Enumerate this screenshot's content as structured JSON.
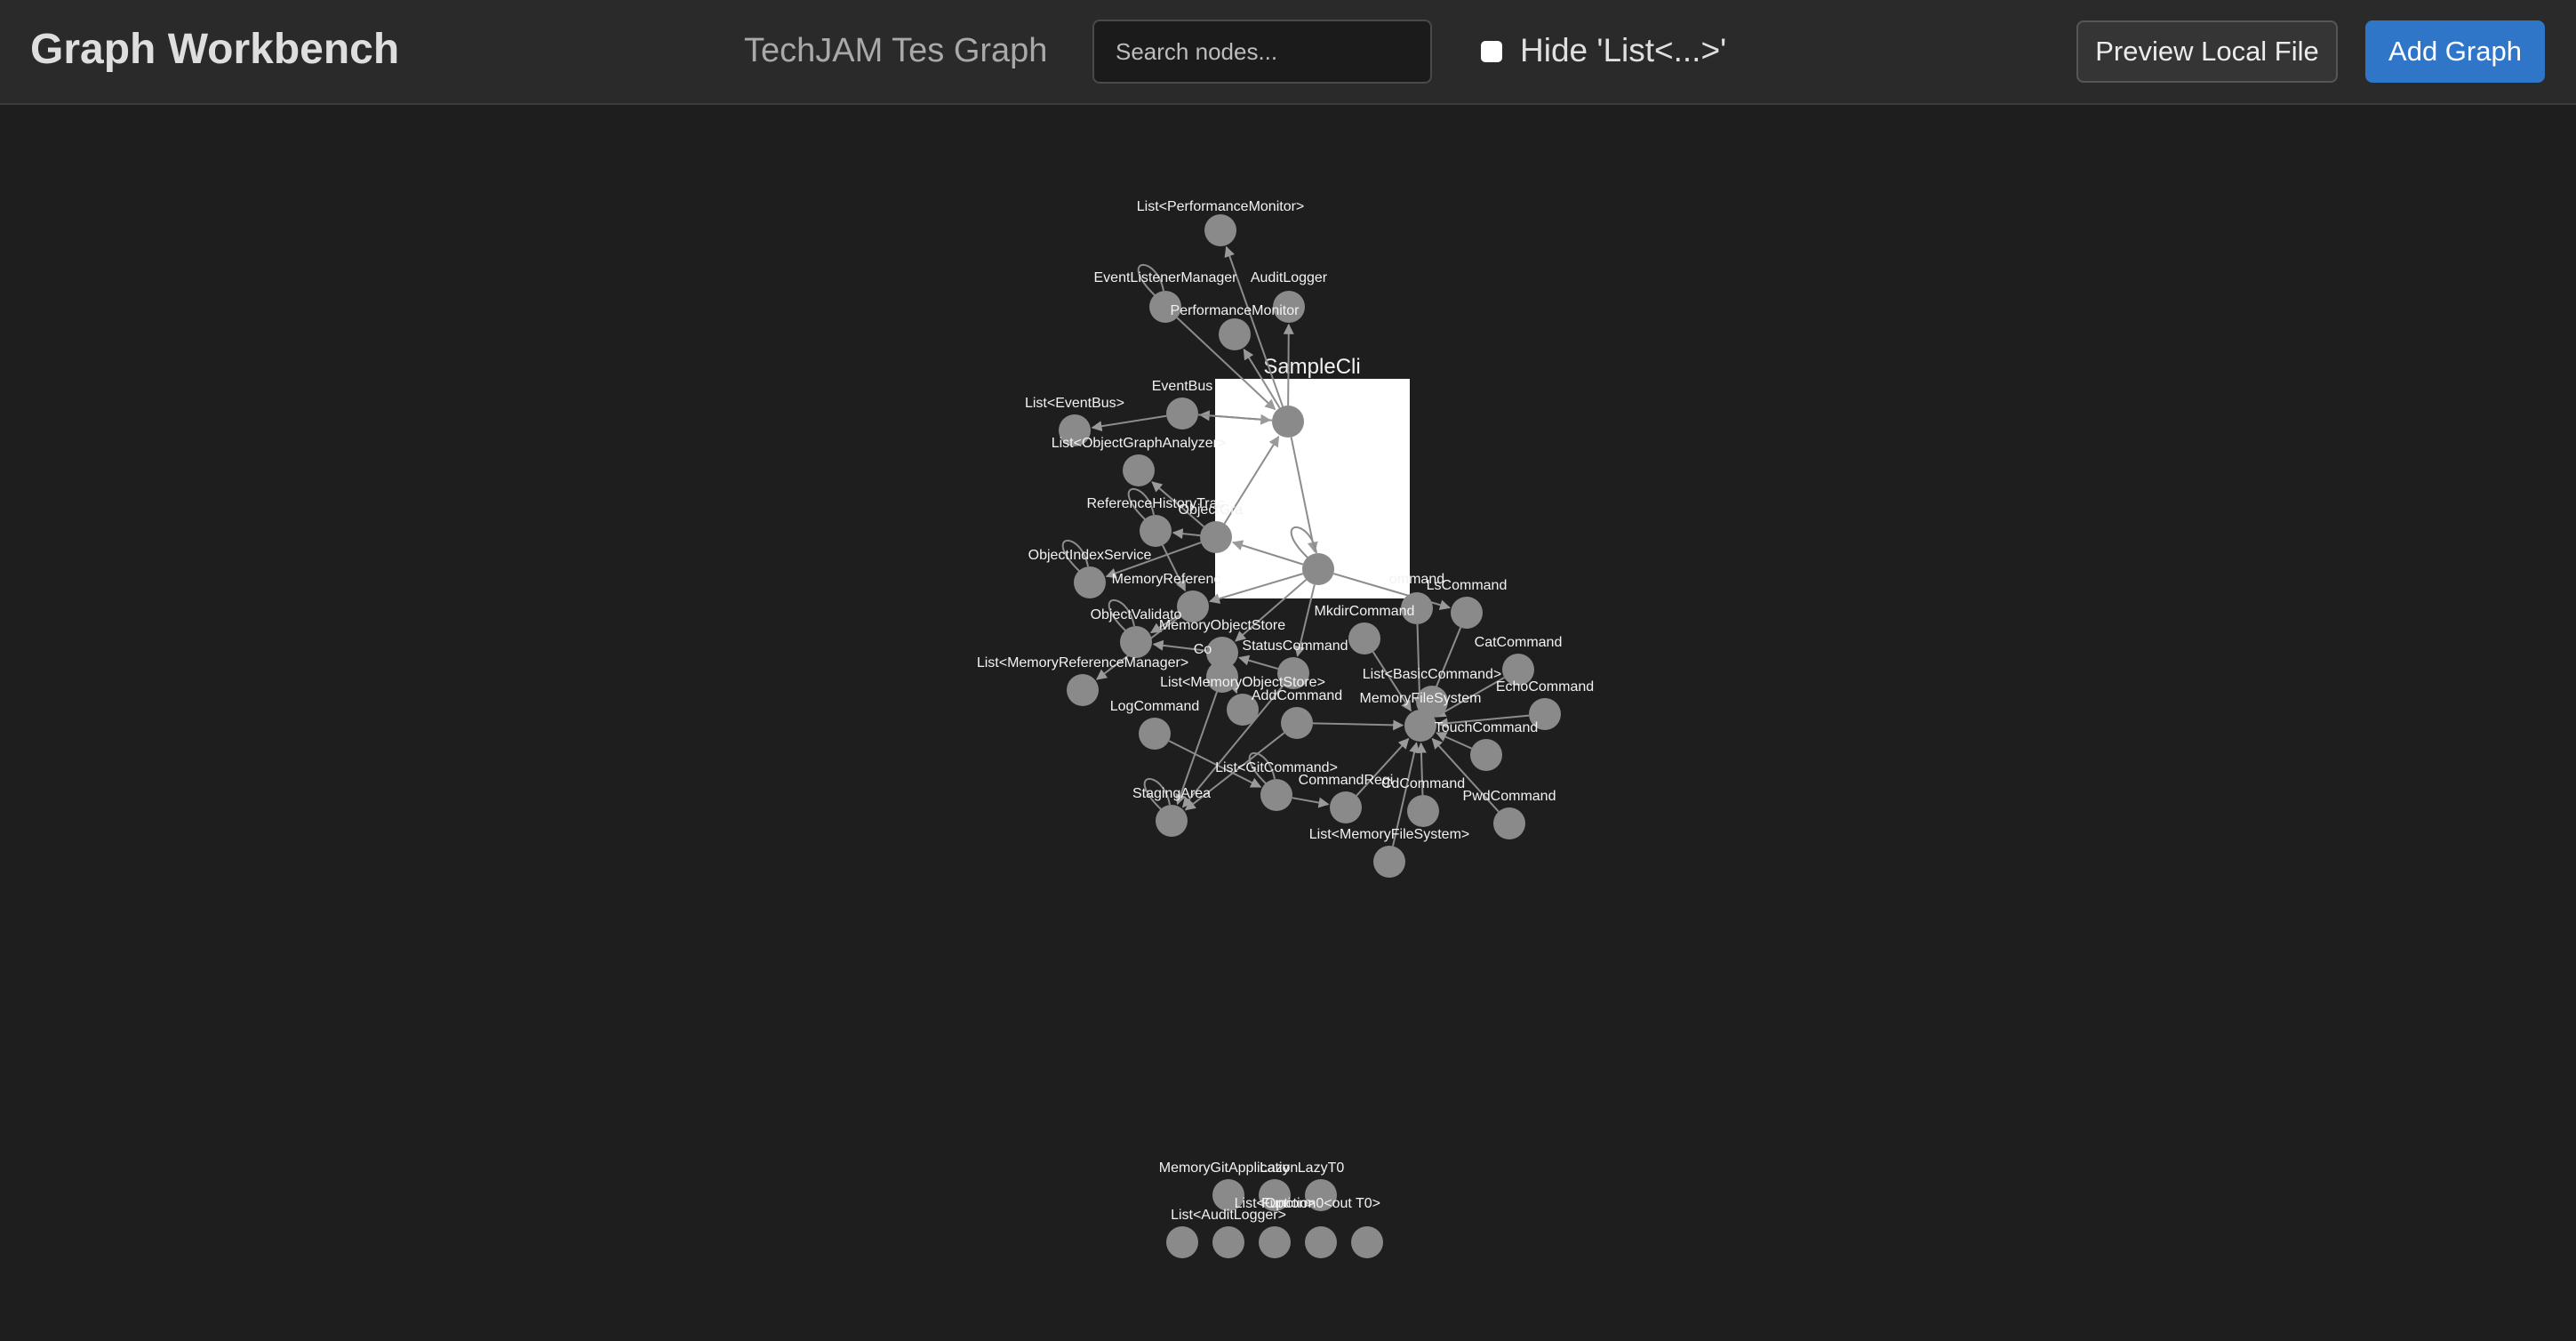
{
  "header": {
    "app_title": "Graph Workbench",
    "graph_name": "TechJAM Tes Graph",
    "search_placeholder": "Search nodes...",
    "hide_list_label": "Hide 'List<...>'",
    "hide_list_checked": false,
    "preview_label": "Preview Local File",
    "add_label": "Add Graph"
  },
  "colors": {
    "background": "#1e1e1e",
    "header": "#2a2a2a",
    "node": "#8a8a8a",
    "edge": "#8c8c8c",
    "accent": "#2f76c9",
    "cluster_box": "#ffffff"
  },
  "graph": {
    "cluster": {
      "label": "SampleCli"
    },
    "nodes": [
      {
        "id": "List<PerformanceMonitor>",
        "label": "List<PerformanceMonitor>"
      },
      {
        "id": "EventListenerManager",
        "label": "EventListenerManager"
      },
      {
        "id": "AuditLogger",
        "label": "AuditLogger"
      },
      {
        "id": "PerformanceMonitor",
        "label": "PerformanceMonitor"
      },
      {
        "id": "EventBus",
        "label": "EventBus"
      },
      {
        "id": "List<EventBus>",
        "label": "List<EventBus>"
      },
      {
        "id": "SampleCliTop",
        "label": ""
      },
      {
        "id": "List<ObjectGraphAnalyzer>",
        "label": "List<ObjectGraphAnalyzer>"
      },
      {
        "id": "ReferenceHistoryTracker",
        "label": "ReferenceHistoryTrac"
      },
      {
        "id": "ObjectGraph",
        "label": "ObjectGra"
      },
      {
        "id": "SampleCliBottom",
        "label": ""
      },
      {
        "id": "ObjectIndexService",
        "label": "ObjectIndexService"
      },
      {
        "id": "MemoryReferenceManager",
        "label": "MemoryReferenc"
      },
      {
        "id": "LsCommand",
        "label": "LsCommand"
      },
      {
        "id": "RmCommand",
        "label": "ommand"
      },
      {
        "id": "ObjectValidator",
        "label": "ObjectValidato"
      },
      {
        "id": "MemoryObjectStore",
        "label": "MemoryObjectStore"
      },
      {
        "id": "MkdirCommand",
        "label": "MkdirCommand"
      },
      {
        "id": "CommitCommand",
        "label": "Co"
      },
      {
        "id": "StatusCommand",
        "label": "StatusCommand"
      },
      {
        "id": "CatCommand",
        "label": "CatCommand"
      },
      {
        "id": "List<MemoryReferenceManager>",
        "label": "List<MemoryReferenceManager>"
      },
      {
        "id": "List<MemoryObjectStore>",
        "label": "List<MemoryObjectStore>"
      },
      {
        "id": "List<BasicCommand>",
        "label": "List<BasicCommand>"
      },
      {
        "id": "EchoCommand",
        "label": "EchoCommand"
      },
      {
        "id": "AddCommand",
        "label": "AddCommand"
      },
      {
        "id": "MemoryFileSystem",
        "label": "MemoryFileSystem"
      },
      {
        "id": "LogCommand",
        "label": "LogCommand"
      },
      {
        "id": "TouchCommand",
        "label": "TouchCommand"
      },
      {
        "id": "List<GitCommand>",
        "label": "List<GitCommand>"
      },
      {
        "id": "CommandRegistry",
        "label": "CommandRegi"
      },
      {
        "id": "CdCommand",
        "label": "CdCommand"
      },
      {
        "id": "StagingArea",
        "label": "StagingArea"
      },
      {
        "id": "PwdCommand",
        "label": "PwdCommand"
      },
      {
        "id": "List<MemoryFileSystem>",
        "label": "List<MemoryFileSystem>"
      },
      {
        "id": "MemoryGitApplication",
        "label": "MemoryGitApplication"
      },
      {
        "id": "Lazy",
        "label": "Lazy"
      },
      {
        "id": "LazyT0",
        "label": "LazyT0"
      },
      {
        "id": "List<Option>",
        "label": "List<Option>"
      },
      {
        "id": "Function0",
        "label": "Function0<out T0>"
      },
      {
        "id": "List<AuditLogger>",
        "label": "List<AuditLogger>"
      },
      {
        "id": "Isolated5",
        "label": ""
      },
      {
        "id": "Isolated6",
        "label": ""
      }
    ],
    "edges": [
      [
        "SampleCliTop",
        "List<PerformanceMonitor>"
      ],
      [
        "SampleCliTop",
        "AuditLogger"
      ],
      [
        "SampleCliTop",
        "PerformanceMonitor"
      ],
      [
        "SampleCliTop",
        "EventBus"
      ],
      [
        "EventListenerManager",
        "SampleCliTop"
      ],
      [
        "EventBus",
        "List<EventBus>"
      ],
      [
        "EventBus",
        "SampleCliTop"
      ],
      [
        "ObjectGraph",
        "SampleCliTop"
      ],
      [
        "SampleCliTop",
        "SampleCliBottom"
      ],
      [
        "SampleCliBottom",
        "ObjectGraph"
      ],
      [
        "SampleCliBottom",
        "MemoryReferenceManager"
      ],
      [
        "SampleCliBottom",
        "MemoryObjectStore"
      ],
      [
        "ObjectGraph",
        "List<ObjectGraphAnalyzer>"
      ],
      [
        "ObjectGraph",
        "ReferenceHistoryTracker"
      ],
      [
        "ObjectGraph",
        "ObjectIndexService"
      ],
      [
        "MemoryReferenceManager",
        "List<MemoryReferenceManager>"
      ],
      [
        "MemoryReferenceManager",
        "ObjectValidator"
      ],
      [
        "MemoryObjectStore",
        "List<MemoryObjectStore>"
      ],
      [
        "MemoryObjectStore",
        "ObjectValidator"
      ],
      [
        "CommitCommand",
        "MemoryObjectStore"
      ],
      [
        "CommitCommand",
        "StagingArea"
      ],
      [
        "StatusCommand",
        "StagingArea"
      ],
      [
        "AddCommand",
        "StagingArea"
      ],
      [
        "LogCommand",
        "List<GitCommand>"
      ],
      [
        "AddCommand",
        "MemoryFileSystem"
      ],
      [
        "List<GitCommand>",
        "CommandRegistry"
      ],
      [
        "CommandRegistry",
        "MemoryFileSystem"
      ],
      [
        "LsCommand",
        "MemoryFileSystem"
      ],
      [
        "RmCommand",
        "MemoryFileSystem"
      ],
      [
        "MkdirCommand",
        "MemoryFileSystem"
      ],
      [
        "CatCommand",
        "MemoryFileSystem"
      ],
      [
        "EchoCommand",
        "MemoryFileSystem"
      ],
      [
        "TouchCommand",
        "MemoryFileSystem"
      ],
      [
        "CdCommand",
        "MemoryFileSystem"
      ],
      [
        "PwdCommand",
        "MemoryFileSystem"
      ],
      [
        "List<MemoryFileSystem>",
        "MemoryFileSystem"
      ],
      [
        "List<BasicCommand>",
        "MemoryFileSystem"
      ],
      [
        "StatusCommand",
        "MemoryObjectStore"
      ],
      [
        "ReferenceHistoryTracker",
        "MemoryReferenceManager"
      ],
      [
        "SampleCliBottom",
        "StatusCommand"
      ],
      [
        "SampleCliBottom",
        "LsCommand"
      ]
    ],
    "self_loops": [
      "EventListenerManager",
      "ObjectIndexService",
      "ReferenceHistoryTracker",
      "StagingArea",
      "SampleCliBottom",
      "ObjectValidator",
      "List<GitCommand>"
    ]
  }
}
